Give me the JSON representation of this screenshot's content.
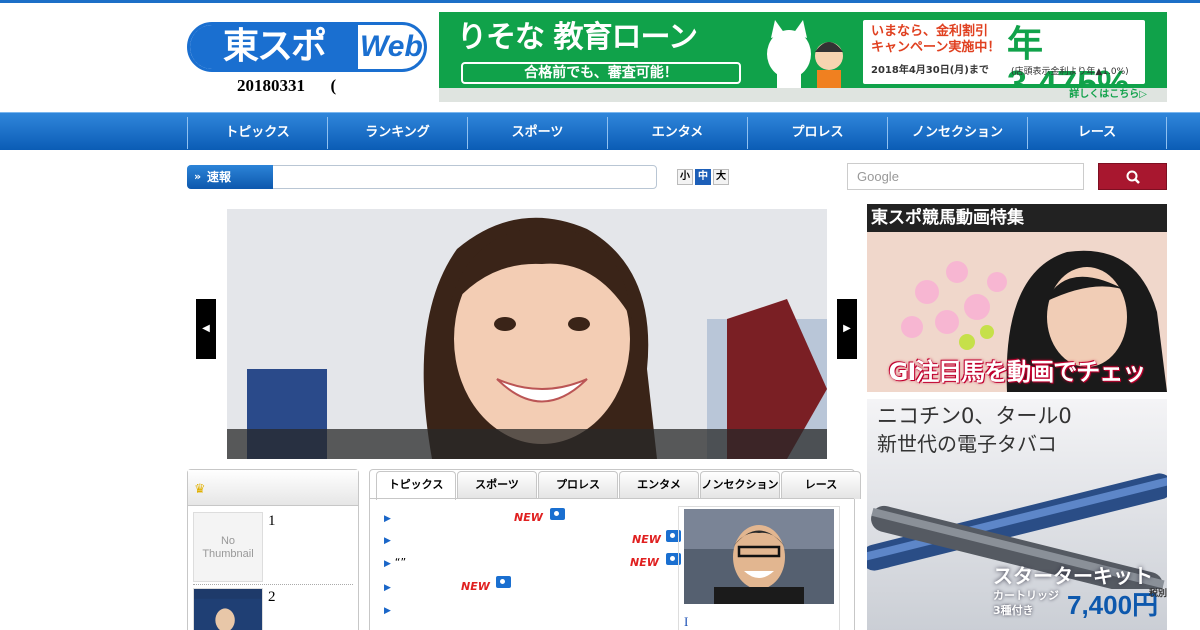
{
  "header": {
    "logo_jp": "東スポ",
    "logo_web": "Web",
    "date": "20180331      ("
  },
  "top_ad": {
    "title": "りそな 教育ローン",
    "subtitle": "合格前でも、審査可能！",
    "promo1": "いまなら、金利割引",
    "promo2": "キャンペーン実施中！",
    "rate": "年3.475%",
    "period": "2018年4月30日(月)まで",
    "note": "(店頭表示金利より年▲1.0%)",
    "more": "詳しくはこちら▷"
  },
  "nav": {
    "items": [
      "トピックス",
      "ランキング",
      "スポーツ",
      "エンタメ",
      "プロレス",
      "ノンセクション",
      "レース"
    ]
  },
  "breaking": {
    "label": "速報"
  },
  "font_size": {
    "small": "小",
    "medium": "中",
    "large": "大"
  },
  "search": {
    "placeholder": "Google"
  },
  "slider": {
    "prev": "◀",
    "next": "▶"
  },
  "ranking": {
    "items": [
      {
        "rank": "1",
        "thumb": "No\nThumbnail"
      },
      {
        "rank": "2"
      }
    ]
  },
  "tabs": {
    "items": [
      "トピックス",
      "スポーツ",
      "プロレス",
      "エンタメ",
      "ノンセクション",
      "レース"
    ],
    "active": "トピックス"
  },
  "articles": {
    "new_label": "NEW",
    "quote": "“”",
    "feature_caption": "I"
  },
  "ads": {
    "keiba_title": "東スポ競馬動画特集",
    "keiba_bottom": "GI注目馬を動画でチェック！",
    "ecig_line1": "ニコチン0、タール0",
    "ecig_line2": "新世代の電子タバコ",
    "ecig_kit": "スターターキット",
    "ecig_cart1": "カートリッジ",
    "ecig_cart2": "3種付き",
    "ecig_price": "7,400円",
    "ecig_tax": "税別"
  }
}
